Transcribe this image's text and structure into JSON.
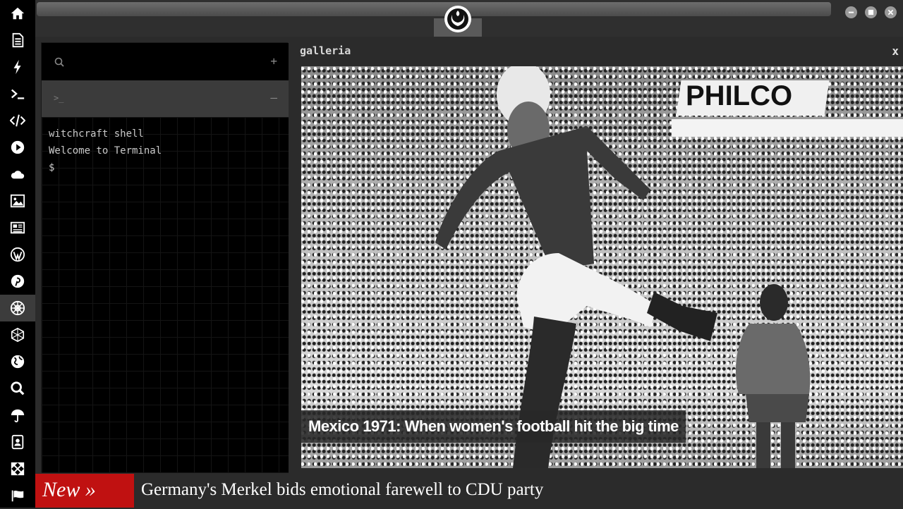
{
  "dock": {
    "items": [
      {
        "icon": "home-icon"
      },
      {
        "icon": "document-icon"
      },
      {
        "icon": "lightning-icon"
      },
      {
        "icon": "terminal-icon"
      },
      {
        "icon": "code-icon"
      },
      {
        "icon": "play-icon"
      },
      {
        "icon": "cloud-icon"
      },
      {
        "icon": "image-icon"
      },
      {
        "icon": "newspaper-icon"
      },
      {
        "icon": "wordpress-icon"
      },
      {
        "icon": "pinterest-icon"
      },
      {
        "icon": "galactic-empire-icon",
        "active": true
      },
      {
        "icon": "network-icon"
      },
      {
        "icon": "globe-icon"
      },
      {
        "icon": "search-icon"
      },
      {
        "icon": "umbrella-icon"
      },
      {
        "icon": "address-book-icon"
      },
      {
        "icon": "expand-icon"
      },
      {
        "icon": "flag-icon"
      }
    ]
  },
  "topbar": {
    "logo_icon": "rebel-alliance-icon",
    "window_buttons": [
      "minimize-icon",
      "maximize-icon",
      "close-icon"
    ]
  },
  "terminal": {
    "search_icon": "search-icon",
    "add_label": "+",
    "tab_prompt": ">_",
    "collapse_label": "–",
    "lines": [
      "witchcraft shell",
      "Welcome to Terminal",
      "$"
    ]
  },
  "galleria": {
    "title": "galleria",
    "close_label": "x",
    "caption": "Mexico 1971: When women's football hit the big time",
    "banner_text": "PHILCO"
  },
  "ticker": {
    "badge": "New »",
    "headline": "Germany's Merkel bids emotional farewell to CDU party"
  },
  "colors": {
    "dock_bg": "#000000",
    "panel_bg": "#2b2b2b",
    "ticker_badge": "#c01111"
  }
}
